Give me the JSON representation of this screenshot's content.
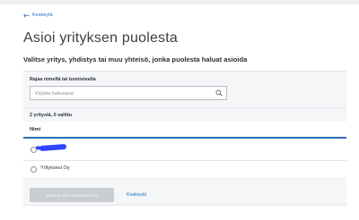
{
  "nav": {
    "back_label": "Keskeytä"
  },
  "page": {
    "title": "Asioi yrityksen puolesta",
    "subtitle": "Valitse yritys, yhdistys tai muu yhteisö, jonka puolesta haluat asioida"
  },
  "filter": {
    "label": "Rajaa nimellä tai tunnisteella",
    "placeholder": "Kirjoita hakusana",
    "value": ""
  },
  "results": {
    "count_text": "2 yritystä, 0 valittu",
    "column_header": "Nimi",
    "rows": [
      {
        "label": "",
        "redacted": true,
        "selected": false
      },
      {
        "label": "Yrityksesi Oy",
        "redacted": false,
        "selected": false
      }
    ]
  },
  "actions": {
    "primary_label": "Valitse ja siirry asiointipalveluun",
    "cancel_label": "Keskeytä"
  },
  "colors": {
    "accent": "#2a6ebb",
    "panel_bg": "#f4f6f8",
    "disabled_button": "#c9cdd2",
    "redaction": "#2f45ff"
  },
  "icons": {
    "back": "arrow-left-icon",
    "search": "search-icon"
  }
}
